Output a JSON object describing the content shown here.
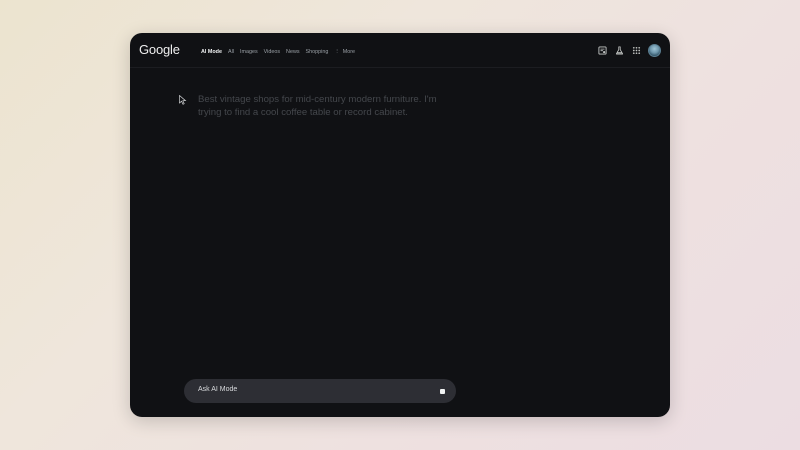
{
  "header": {
    "logo": "Google",
    "nav": [
      "AI Mode",
      "All",
      "Images",
      "Videos",
      "News",
      "Shopping"
    ],
    "more": "More",
    "icons": [
      "lab-flask-icon",
      "apps-grid-icon",
      "history-icon"
    ]
  },
  "main": {
    "query": "Best vintage shops for mid-century modern furniture. I'm trying to find a cool coffee table or record cabinet."
  },
  "ask_bar": {
    "placeholder": "Ask AI Mode",
    "stop_icon": "stop-icon"
  },
  "colors": {
    "window_bg": "#101114",
    "ask_bar_bg": "#2d2e34",
    "query_text": "#44474c"
  }
}
